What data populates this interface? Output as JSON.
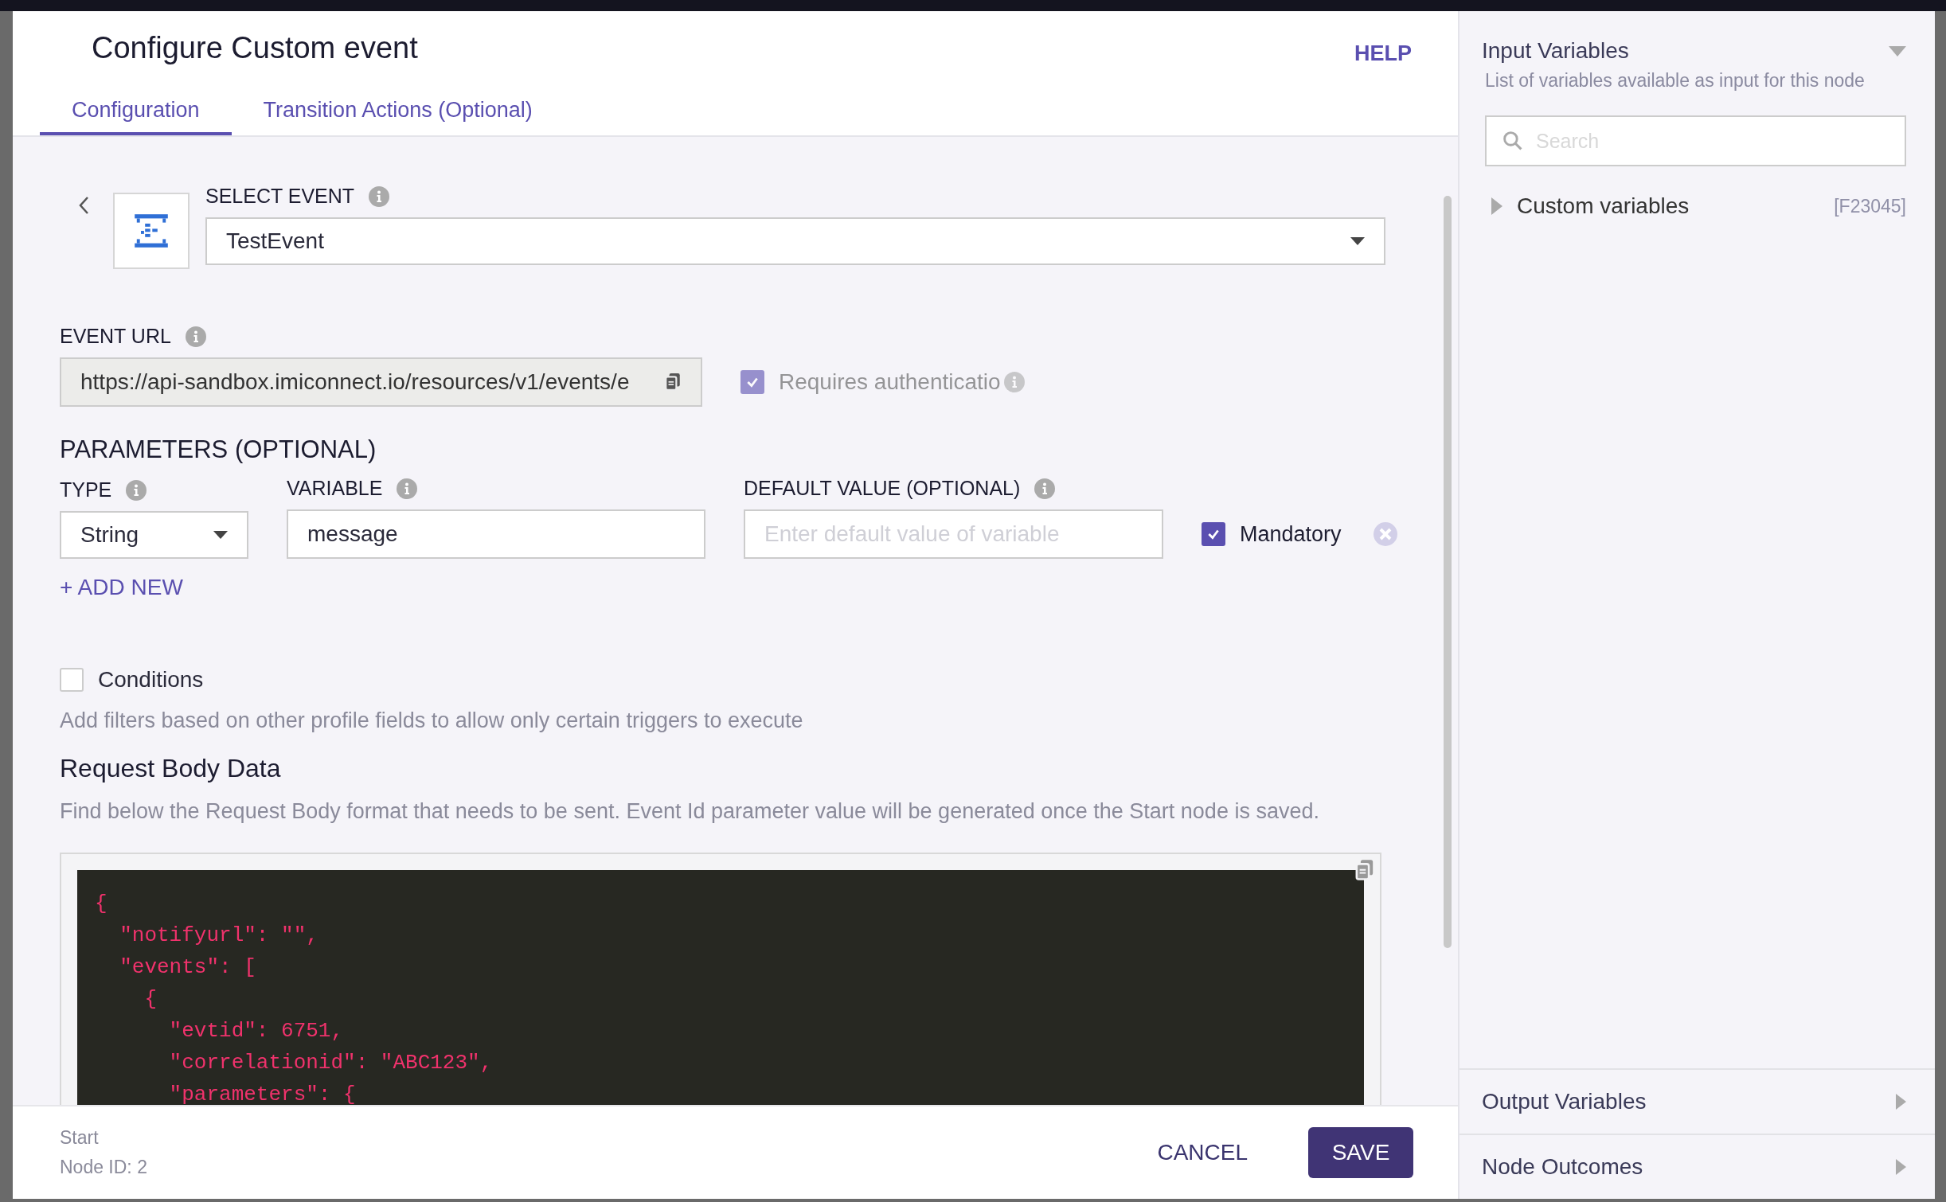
{
  "dialog": {
    "title": "Configure Custom event",
    "help": "HELP"
  },
  "tabs": [
    {
      "label": "Configuration",
      "selected": true
    },
    {
      "label": "Transition Actions (Optional)",
      "selected": false
    }
  ],
  "select_event": {
    "label": "SELECT EVENT",
    "value": "TestEvent"
  },
  "event_url": {
    "label": "EVENT URL",
    "value": "https://api-sandbox.imiconnect.io/resources/v1/events/e"
  },
  "requires_auth": {
    "label": "Requires authenticatio",
    "checked": true,
    "disabled": true
  },
  "parameters": {
    "heading": "PARAMETERS (OPTIONAL)",
    "type_label": "TYPE",
    "variable_label": "VARIABLE",
    "default_label": "DEFAULT VALUE (OPTIONAL)",
    "rows": [
      {
        "type": "String",
        "variable": "message",
        "default_placeholder": "Enter default value of variable",
        "mandatory_label": "Mandatory",
        "mandatory": true
      }
    ],
    "add_new": "+ ADD NEW"
  },
  "conditions": {
    "label": "Conditions",
    "checked": false,
    "description": "Add filters based on other profile fields to allow only certain triggers to execute"
  },
  "request_body": {
    "title": "Request Body Data",
    "description": "Find below the Request Body format that needs to be sent. Event Id parameter value will be generated once the Start node is saved.",
    "code": [
      "{",
      "  \"notifyurl\": \"\",",
      "  \"events\": [",
      "    {",
      "      \"evtid\": 6751,",
      "      \"correlationid\": \"ABC123\",",
      "      \"parameters\": {"
    ]
  },
  "footer": {
    "node_type": "Start",
    "node_id_label": "Node ID:",
    "node_id": "2",
    "cancel": "CANCEL",
    "save": "SAVE"
  },
  "input_variables": {
    "title": "Input Variables",
    "subtitle": "List of variables available as input for this node",
    "expanded": true,
    "search_placeholder": "Search",
    "items": [
      {
        "label": "Custom variables",
        "code": "[F23045]",
        "expanded": false
      }
    ]
  },
  "sections": [
    {
      "label": "Output Variables",
      "expanded": false
    },
    {
      "label": "Node Outcomes",
      "expanded": false
    }
  ]
}
